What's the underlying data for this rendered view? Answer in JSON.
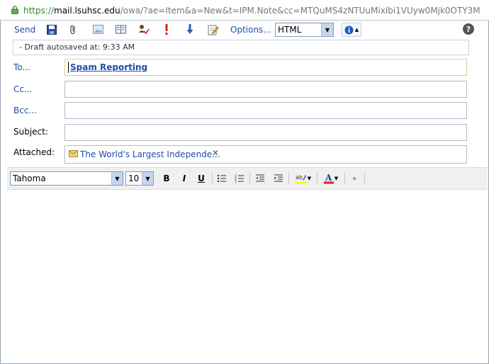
{
  "url": {
    "scheme": "https://",
    "host": "mail.lsuhsc.edu",
    "path": "/owa/?ae=Item&a=New&t=IPM.Note&cc=MTQuMS4zNTUuMixlbi1VUyw0Mjk0OTY3M"
  },
  "toolbar": {
    "send_label": "Send",
    "options_label": "Options...",
    "format_value": "HTML",
    "help_label": "?"
  },
  "draft_status": "- Draft autosaved at: 9:33 AM",
  "fields": {
    "to_label": "To...",
    "to_value": "Spam Reporting",
    "cc_label": "Cc...",
    "bcc_label": "Bcc...",
    "subject_label": "Subject:",
    "attached_label": "Attached:",
    "attachment_name": "The World's Largest Independe..."
  },
  "formatting": {
    "font": "Tahoma",
    "size": "10"
  },
  "colors": {
    "link": "#1f4ea8",
    "url_scheme": "#2c8a2c"
  }
}
